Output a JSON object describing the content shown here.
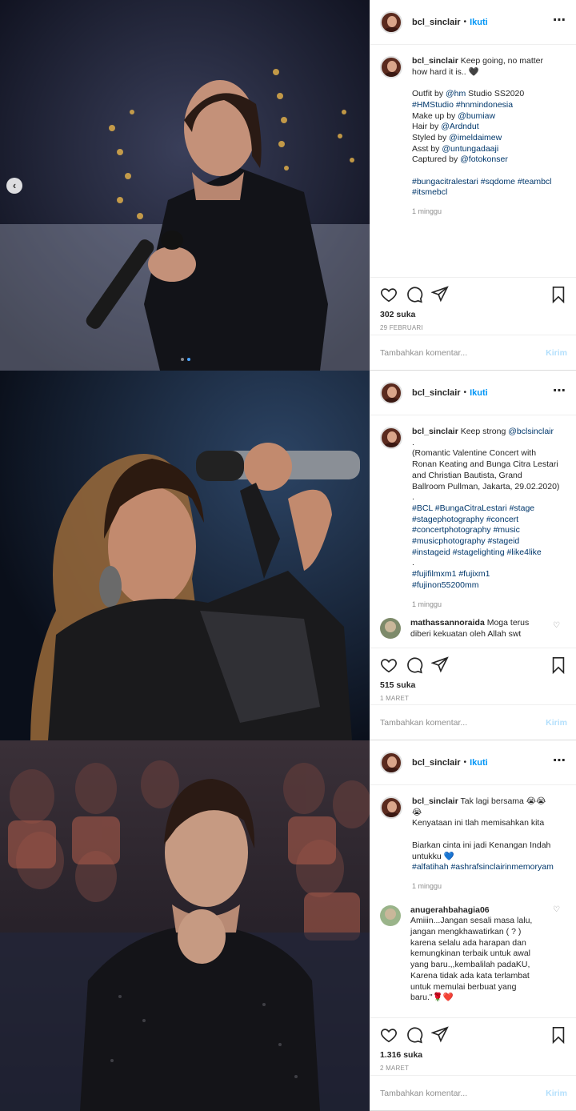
{
  "posts": [
    {
      "username": "bcl_sinclair",
      "follow_label": "Ikuti",
      "separator": "•",
      "more_label": "•••",
      "caption": {
        "username": "bcl_sinclair",
        "lines": [
          "Keep going, no matter",
          "how hard it is.. 🖤",
          "",
          "Outfit by @hm Studio SS2020",
          "#HMStudio #hnmindonesia",
          "Make up by @bumiaw",
          "Hair by @Ardndut",
          "Styled by @imeldaimew",
          "Asst by @untungadaaji",
          "Captured by @fotokonser",
          "",
          "#bungacitralestari #sqdome #teambcl",
          "#itsmebcl"
        ],
        "time": "1 minggu"
      },
      "likes": "302 suka",
      "date": "29 FEBRUARI",
      "add_comment_placeholder": "Tambahkan komentar...",
      "send_label": "Kirim",
      "carousel": {
        "prev_icon": "‹",
        "slide_count": 2,
        "active_slide": 2
      }
    },
    {
      "username": "bcl_sinclair",
      "follow_label": "Ikuti",
      "separator": "•",
      "more_label": "•••",
      "caption": {
        "username": "bcl_sinclair",
        "lines": [
          "Keep strong @bclsinclair",
          ".",
          "(Romantic Valentine Concert with",
          "Ronan Keating and Bunga Citra Lestari",
          "and Christian Bautista, Grand",
          "Ballroom Pullman, Jakarta, 29.02.2020)",
          ".",
          "#BCL #BungaCitraLestari #stage",
          "#stagephotography #concert",
          "#concertphotography #music",
          "#musicphotography #stageid",
          "#instageid #stagelighting #like4like",
          ".",
          "#fujifilmxm1 #fujixm1",
          "#fujinon55200mm"
        ],
        "time": "1 minggu"
      },
      "comment": {
        "username": "mathassannoraida",
        "lines": [
          "Moga terus",
          "diberi kekuatan oleh Allah swt"
        ],
        "heart": "♡"
      },
      "likes": "515 suka",
      "date": "1 MARET",
      "add_comment_placeholder": "Tambahkan komentar...",
      "send_label": "Kirim"
    },
    {
      "username": "bcl_sinclair",
      "follow_label": "Ikuti",
      "separator": "•",
      "more_label": "•••",
      "caption": {
        "username": "bcl_sinclair",
        "lines": [
          "Tak lagi bersama 😭😭",
          "😭",
          "Kenyataan ini tlah memisahkan kita",
          "",
          "Biarkan cinta ini jadi Kenangan Indah",
          "untukku 💙",
          "#alfatihah #ashrafsinclairinmemoryam"
        ],
        "time": "1 minggu"
      },
      "comment": {
        "username": "anugerahbahagia06",
        "lines": [
          "Amiiin...Jangan sesali masa lalu,",
          "jangan mengkhawatirkan ( ? )",
          "karena selalu ada harapan dan",
          "kemungkinan terbaik untuk awal",
          "yang baru.,,kembalilah padaKU,",
          "Karena tidak ada kata terlambat",
          "untuk memulai berbuat yang",
          "baru.\"🌹❤️"
        ],
        "heart": "♡"
      },
      "likes": "1.316 suka",
      "date": "2 MARET",
      "add_comment_placeholder": "Tambahkan komentar...",
      "send_label": "Kirim"
    }
  ],
  "colors": {
    "link": "#00376b",
    "follow": "#0095f6",
    "muted": "#8e8e8e",
    "send_disabled": "#b2dffc"
  }
}
